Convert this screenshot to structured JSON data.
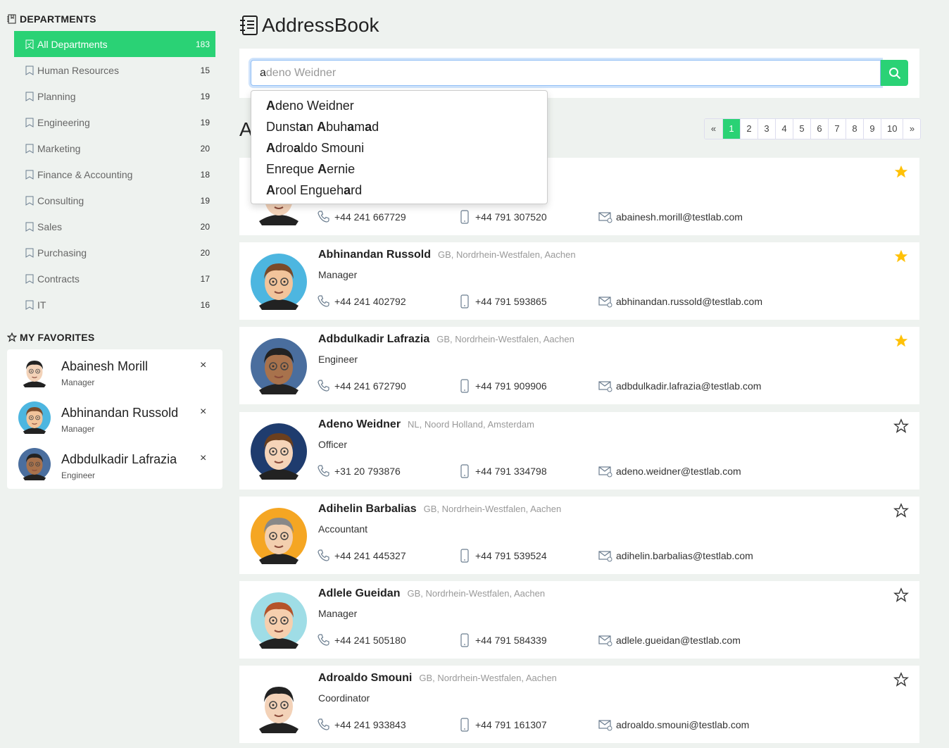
{
  "colors": {
    "accent": "#2ad275",
    "star": "#ffc107"
  },
  "sidebar": {
    "departments_title": "DEPARTMENTS",
    "departments": [
      {
        "label": "All Departments",
        "count": "183",
        "active": true
      },
      {
        "label": "Human Resources",
        "count": "15"
      },
      {
        "label": "Planning",
        "count": "19"
      },
      {
        "label": "Engineering",
        "count": "19"
      },
      {
        "label": "Marketing",
        "count": "20"
      },
      {
        "label": "Finance & Accounting",
        "count": "18"
      },
      {
        "label": "Consulting",
        "count": "19"
      },
      {
        "label": "Sales",
        "count": "20"
      },
      {
        "label": "Purchasing",
        "count": "20"
      },
      {
        "label": "Contracts",
        "count": "17"
      },
      {
        "label": "IT",
        "count": "16"
      }
    ],
    "favorites_title": "MY FAVORITES",
    "favorites": [
      {
        "name": "Abainesh Morill",
        "role": "Manager",
        "avatar_bg": "#ffffff",
        "hair": "#222",
        "skin": "#f3d2b8"
      },
      {
        "name": "Abhinandan Russold",
        "role": "Manager",
        "avatar_bg": "#4db6e0",
        "hair": "#7a4a2a",
        "skin": "#f2c49b"
      },
      {
        "name": "Adbdulkadir Lafrazia",
        "role": "Engineer",
        "avatar_bg": "#4a6e9e",
        "hair": "#222",
        "skin": "#a8724c"
      }
    ],
    "remove_label": "×"
  },
  "header": {
    "title": "AddressBook"
  },
  "search": {
    "typed": "a",
    "suggestion_rest": "deno Weidner",
    "button_icon": "search-icon"
  },
  "suggestions": [
    [
      {
        "t": "A",
        "b": true
      },
      {
        "t": "deno Weidner"
      }
    ],
    [
      {
        "t": "Dunst"
      },
      {
        "t": "a",
        "b": true
      },
      {
        "t": "n "
      },
      {
        "t": "A",
        "b": true
      },
      {
        "t": "buh"
      },
      {
        "t": "a",
        "b": true
      },
      {
        "t": "m"
      },
      {
        "t": "a",
        "b": true
      },
      {
        "t": "d"
      }
    ],
    [
      {
        "t": "A",
        "b": true
      },
      {
        "t": "dro"
      },
      {
        "t": "a",
        "b": true
      },
      {
        "t": "ldo Smouni"
      }
    ],
    [
      {
        "t": "Enreque "
      },
      {
        "t": "A",
        "b": true
      },
      {
        "t": "ernie"
      }
    ],
    [
      {
        "t": "A",
        "b": true
      },
      {
        "t": "rool Engueh"
      },
      {
        "t": "a",
        "b": true
      },
      {
        "t": "rd"
      }
    ]
  ],
  "section_letter": "A",
  "pagination": {
    "prev": "«",
    "pages": [
      "1",
      "2",
      "3",
      "4",
      "5",
      "6",
      "7",
      "8",
      "9",
      "10"
    ],
    "current": "1",
    "next": "»"
  },
  "contacts": [
    {
      "name": "",
      "location": "",
      "role": "",
      "phone": "+44 241 667729",
      "mobile": "+44 791 307520",
      "email": "abainesh.morill@testlab.com",
      "favorite": true,
      "avatar_bg": "#ffffff",
      "hair": "#222",
      "skin": "#f3d2b8"
    },
    {
      "name": "Abhinandan Russold",
      "location": "GB, Nordrhein-Westfalen, Aachen",
      "role": "Manager",
      "phone": "+44 241 402792",
      "mobile": "+44 791 593865",
      "email": "abhinandan.russold@testlab.com",
      "favorite": true,
      "avatar_bg": "#4db6e0",
      "hair": "#7a4a2a",
      "skin": "#f2c49b"
    },
    {
      "name": "Adbdulkadir Lafrazia",
      "location": "GB, Nordrhein-Westfalen, Aachen",
      "role": "Engineer",
      "phone": "+44 241 672790",
      "mobile": "+44 791 909906",
      "email": "adbdulkadir.lafrazia@testlab.com",
      "favorite": true,
      "avatar_bg": "#4a6e9e",
      "hair": "#222",
      "skin": "#a8724c"
    },
    {
      "name": "Adeno Weidner",
      "location": "NL, Noord Holland, Amsterdam",
      "role": "Officer",
      "phone": "+31 20 793876",
      "mobile": "+44 791 334798",
      "email": "adeno.weidner@testlab.com",
      "favorite": false,
      "avatar_bg": "#1f3c6e",
      "hair": "#6b3f1e",
      "skin": "#f6d4b8"
    },
    {
      "name": "Adihelin Barbalias",
      "location": "GB, Nordrhein-Westfalen, Aachen",
      "role": "Accountant",
      "phone": "+44 241 445327",
      "mobile": "+44 791 539524",
      "email": "adihelin.barbalias@testlab.com",
      "favorite": false,
      "avatar_bg": "#f5a623",
      "hair": "#888",
      "skin": "#f3cfae"
    },
    {
      "name": "Adlele Gueidan",
      "location": "GB, Nordrhein-Westfalen, Aachen",
      "role": "Manager",
      "phone": "+44 241 505180",
      "mobile": "+44 791 584339",
      "email": "adlele.gueidan@testlab.com",
      "favorite": false,
      "avatar_bg": "#9fdde6",
      "hair": "#b5532a",
      "skin": "#f6cfae"
    },
    {
      "name": "Adroaldo Smouni",
      "location": "GB, Nordrhein-Westfalen, Aachen",
      "role": "Coordinator",
      "phone": "+44 241 933843",
      "mobile": "+44 791 161307",
      "email": "adroaldo.smouni@testlab.com",
      "favorite": false,
      "avatar_bg": "#ffffff",
      "hair": "#222",
      "skin": "#f3d2b8"
    }
  ]
}
